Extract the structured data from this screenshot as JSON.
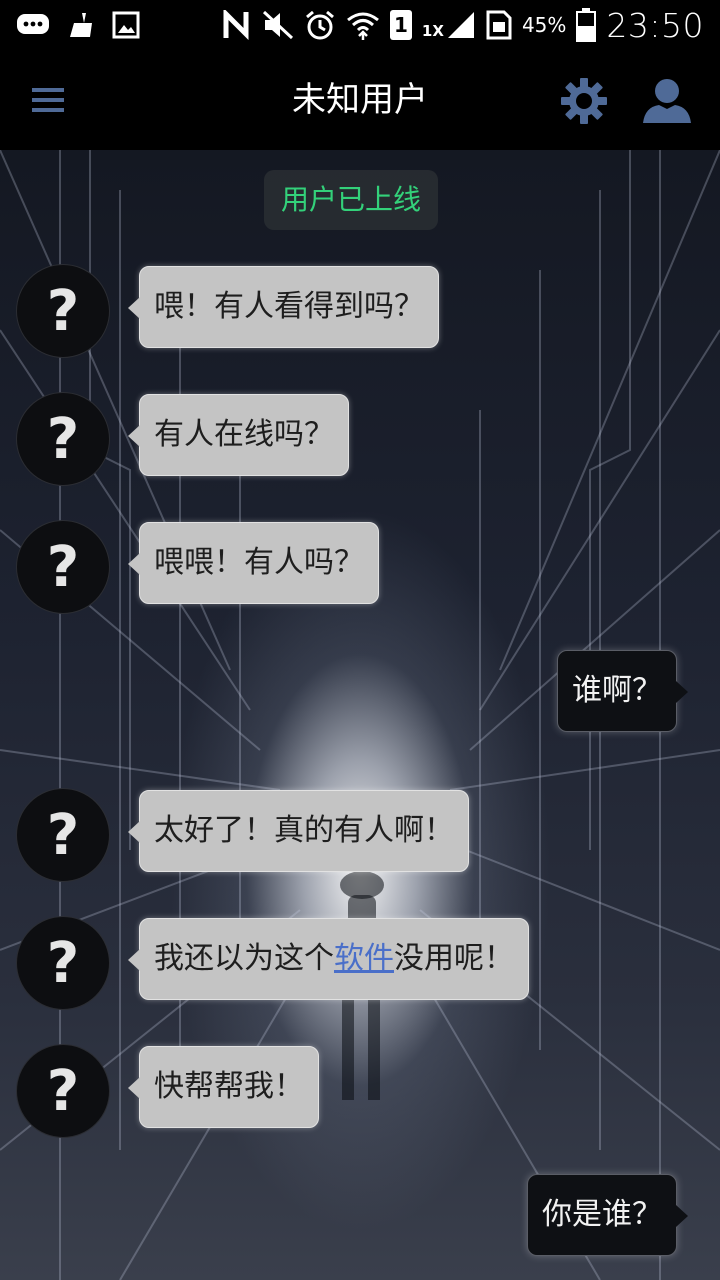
{
  "status_bar": {
    "left_icons": [
      "message-icon",
      "cleaner-icon",
      "gallery-icon"
    ],
    "right_icons": [
      "nfc-icon",
      "mute-icon",
      "alarm-icon",
      "wifi-icon",
      "sim-icon",
      "signal-icon",
      "sim-card-icon",
      "battery-icon"
    ],
    "sim_number": "1",
    "network_label": "1X",
    "battery": "45%",
    "time": "23:50"
  },
  "app_bar": {
    "title": "未知用户",
    "accent_color": "#4f6a97"
  },
  "chat": {
    "system_message": "用户已上线",
    "avatar_symbol": "?",
    "messages": [
      {
        "from": "other",
        "text": "喂！有人看得到吗？"
      },
      {
        "from": "other",
        "text": "有人在线吗？"
      },
      {
        "from": "other",
        "text": "喂喂！有人吗？"
      },
      {
        "from": "me",
        "text": "谁啊？"
      },
      {
        "from": "other",
        "text": "太好了！真的有人啊！"
      },
      {
        "from": "other",
        "text_before": "我还以为这个",
        "link_text": "软件",
        "text_after": "没用呢！"
      },
      {
        "from": "other",
        "text": "快帮帮我！"
      },
      {
        "from": "me",
        "text": "你是谁？"
      }
    ]
  }
}
